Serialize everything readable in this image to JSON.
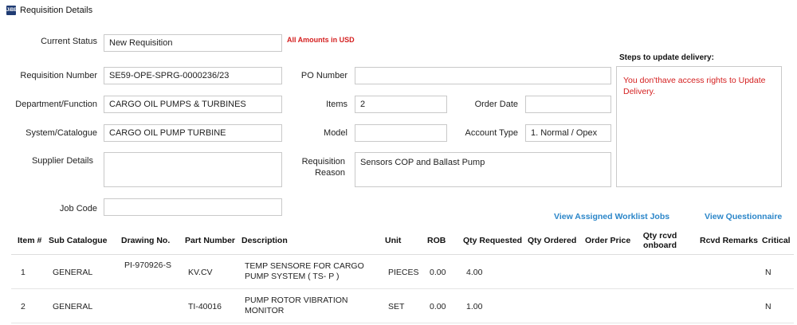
{
  "window": {
    "title": "Requisition Details",
    "icon_label": "JiBE"
  },
  "form": {
    "current_status": {
      "label": "Current Status",
      "value": "New Requisition"
    },
    "amounts_note": "All Amounts in USD",
    "requisition_number": {
      "label": "Requisition Number",
      "value": "SE59-OPE-SPRG-0000236/23"
    },
    "po_number": {
      "label": "PO Number",
      "value": ""
    },
    "department": {
      "label": "Department/Function",
      "value": "CARGO OIL PUMPS & TURBINES"
    },
    "items": {
      "label": "Items",
      "value": "2"
    },
    "order_date": {
      "label": "Order Date",
      "value": ""
    },
    "system_catalogue": {
      "label": "System/Catalogue",
      "value": "CARGO OIL PUMP TURBINE"
    },
    "model": {
      "label": "Model",
      "value": ""
    },
    "account_type": {
      "label": "Account Type",
      "value": "1. Normal / Opex"
    },
    "supplier_details": {
      "label": "Supplier Details",
      "value": ""
    },
    "requisition_reason": {
      "label_line1": "Requisition",
      "label_line2": "Reason",
      "value": "Sensors COP and Ballast Pump"
    },
    "job_code": {
      "label": "Job Code",
      "value": ""
    }
  },
  "delivery": {
    "title": "Steps to update delivery:",
    "message": "You don'thave access rights to Update Delivery."
  },
  "links": {
    "worklist": "View Assigned Worklist Jobs",
    "questionnaire": "View Questionnaire"
  },
  "table": {
    "headers": {
      "item_no": "Item #",
      "sub_catalogue": "Sub Catalogue",
      "drawing_no": "Drawing No.",
      "part_number": "Part Number",
      "description": "Description",
      "unit": "Unit",
      "rob": "ROB",
      "qty_requested": "Qty Requested",
      "qty_ordered": "Qty Ordered",
      "order_price": "Order Price",
      "qty_rcvd_line1": "Qty rcvd",
      "qty_rcvd_line2": "onboard",
      "rcvd_remarks": "Rcvd Remarks",
      "critical": "Critical"
    },
    "rows": [
      {
        "item_no": "1",
        "sub_catalogue": "GENERAL",
        "drawing_no": "PI-970926-S",
        "part_number": "KV.CV",
        "description_line1": "TEMP SENSORE FOR CARGO",
        "description_line2": "PUMP SYSTEM ( TS- P )",
        "unit": "PIECES",
        "rob": "0.00",
        "qty_requested": "4.00",
        "critical": "N"
      },
      {
        "item_no": "2",
        "sub_catalogue": "GENERAL",
        "drawing_no": "",
        "part_number": "TI-40016",
        "description_line1": "PUMP ROTOR VIBRATION",
        "description_line2": "MONITOR",
        "unit": "SET",
        "rob": "0.00",
        "qty_requested": "1.00",
        "critical": "N"
      }
    ]
  },
  "colors": {
    "accent_red": "#d42020",
    "link_blue": "#2b86c9",
    "border": "#c9c9c9"
  }
}
